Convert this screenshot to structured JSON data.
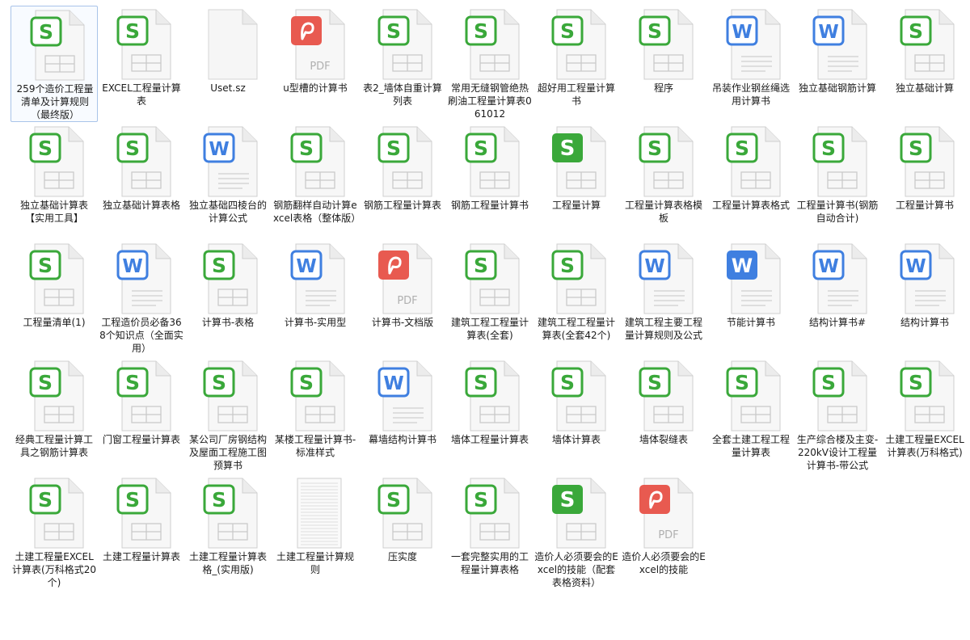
{
  "colors": {
    "sheet_green": "#3aa83a",
    "doc_blue": "#3f7fe0",
    "pdf_red": "#e85a50",
    "selection_border": "#a9c4e9"
  },
  "files": [
    {
      "name": "259个造价工程量清单及计算规则（最终版）",
      "type": "sheet",
      "selected": true
    },
    {
      "name": "EXCEL工程量计算表",
      "type": "sheet"
    },
    {
      "name": "Uset.sz",
      "type": "blank"
    },
    {
      "name": "u型槽的计算书",
      "type": "pdf"
    },
    {
      "name": "表2_墙体自重计算列表",
      "type": "sheet"
    },
    {
      "name": "常用无缝钢管绝热刷油工程量计算表061012",
      "type": "sheet"
    },
    {
      "name": "超好用工程量计算书",
      "type": "sheet"
    },
    {
      "name": "程序",
      "type": "sheet"
    },
    {
      "name": "吊装作业钢丝绳选用计算书",
      "type": "doc"
    },
    {
      "name": "独立基础钢筋计算",
      "type": "doc"
    },
    {
      "name": "独立基础计算",
      "type": "sheet"
    },
    {
      "name": "独立基础计算表【实用工具】",
      "type": "sheet"
    },
    {
      "name": "独立基础计算表格",
      "type": "sheet"
    },
    {
      "name": "独立基础四棱台的计算公式",
      "type": "doc"
    },
    {
      "name": "钢筋翻样自动计算excel表格（整体版）",
      "type": "sheet"
    },
    {
      "name": "钢筋工程量计算表",
      "type": "sheet"
    },
    {
      "name": "钢筋工程量计算书",
      "type": "sheet"
    },
    {
      "name": "工程量计算",
      "type": "sheet",
      "filled": true
    },
    {
      "name": "工程量计算表格模板",
      "type": "sheet"
    },
    {
      "name": "工程量计算表格式",
      "type": "sheet"
    },
    {
      "name": "工程量计算书(钢筋自动合计)",
      "type": "sheet"
    },
    {
      "name": "工程量计算书",
      "type": "sheet"
    },
    {
      "name": "工程量清单(1)",
      "type": "sheet"
    },
    {
      "name": "工程造价员必备368个知识点（全面实用）",
      "type": "doc"
    },
    {
      "name": "计算书-表格",
      "type": "sheet"
    },
    {
      "name": "计算书-实用型",
      "type": "doc"
    },
    {
      "name": "计算书-文档版",
      "type": "pdf"
    },
    {
      "name": "建筑工程工程量计算表(全套)",
      "type": "sheet"
    },
    {
      "name": "建筑工程工程量计算表(全套42个)",
      "type": "sheet"
    },
    {
      "name": "建筑工程主要工程量计算规则及公式",
      "type": "doc"
    },
    {
      "name": "节能计算书",
      "type": "doc",
      "filled": true
    },
    {
      "name": "结构计算书#",
      "type": "doc"
    },
    {
      "name": "结构计算书",
      "type": "doc"
    },
    {
      "name": "经典工程量计算工具之钢筋计算表",
      "type": "sheet"
    },
    {
      "name": "门窗工程量计算表",
      "type": "sheet"
    },
    {
      "name": "某公司厂房钢结构及屋面工程施工图预算书",
      "type": "sheet"
    },
    {
      "name": "某楼工程量计算书-标准样式",
      "type": "sheet"
    },
    {
      "name": "幕墙结构计算书",
      "type": "doc"
    },
    {
      "name": "墙体工程量计算表",
      "type": "sheet"
    },
    {
      "name": "墙体计算表",
      "type": "sheet"
    },
    {
      "name": "墙体裂缝表",
      "type": "sheet"
    },
    {
      "name": "全套土建工程工程量计算表",
      "type": "sheet"
    },
    {
      "name": "生产综合楼及主变-220kV设计工程量计算书-带公式",
      "type": "sheet"
    },
    {
      "name": "土建工程量EXCEL计算表(万科格式)",
      "type": "sheet"
    },
    {
      "name": "土建工程量EXCEL计算表(万科格式20个)",
      "type": "sheet"
    },
    {
      "name": "土建工程量计算表",
      "type": "sheet"
    },
    {
      "name": "土建工程量计算表格_(实用版)",
      "type": "sheet"
    },
    {
      "name": "土建工程量计算规则",
      "type": "text"
    },
    {
      "name": "压实度",
      "type": "sheet"
    },
    {
      "name": "一套完整实用的工程量计算表格",
      "type": "sheet"
    },
    {
      "name": "造价人必须要会的Excel的技能（配套表格资料）",
      "type": "sheet",
      "filled": true
    },
    {
      "name": "造价人必须要会的Excel的技能",
      "type": "pdf"
    }
  ]
}
